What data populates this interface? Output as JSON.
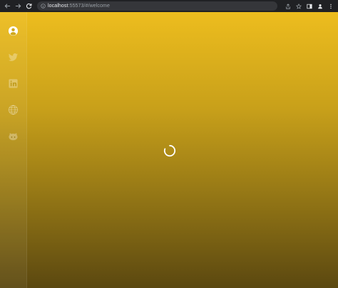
{
  "browser": {
    "url_host": "localhost",
    "url_rest": ":55573/#/welcome"
  },
  "sidebar": {
    "items": [
      {
        "icon": "user-circle-icon",
        "active": true
      },
      {
        "icon": "twitter-icon",
        "active": false
      },
      {
        "icon": "linkedin-icon",
        "active": false
      },
      {
        "icon": "globe-icon",
        "active": false
      },
      {
        "icon": "github-icon",
        "active": false
      }
    ]
  },
  "main": {
    "loading": true
  },
  "colors": {
    "gradient_top": "#edbd1e",
    "gradient_bottom": "#5b4810",
    "browser_chrome": "#202124"
  }
}
